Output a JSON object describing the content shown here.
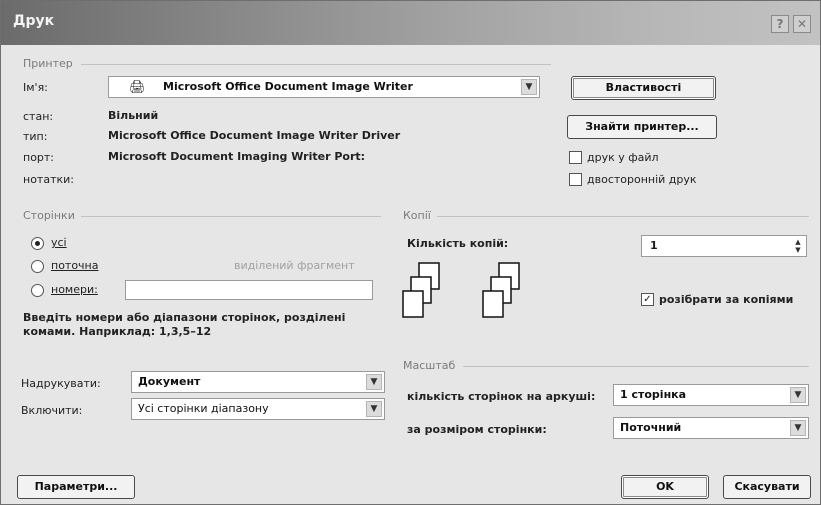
{
  "window": {
    "title": "Друк",
    "help_glyph": "?",
    "close_glyph": "✕"
  },
  "printer": {
    "group_label": "Принтер",
    "name_label": "Ім'я:",
    "name_value": "Microsoft Office Document Image Writer",
    "status_label": "стан:",
    "status_value": "Вільний",
    "type_label": "тип:",
    "type_value": "Microsoft Office Document Image Writer Driver",
    "port_label": "порт:",
    "port_value": "Microsoft Document Imaging Writer Port:",
    "notes_label": "нотатки:",
    "properties_button": "Властивості",
    "find_printer_button": "Знайти принтер...",
    "print_to_file_label": "друк у файл",
    "duplex_label": "двосторонній друк"
  },
  "pages": {
    "group_label": "Сторінки",
    "all_label": "усі",
    "current_label": "поточна",
    "selection_label": "виділений фрагмент",
    "numbers_label": "номери:",
    "numbers_value": "",
    "hint": "Введіть номери або діапазони сторінок, розділені комами. Наприклад: 1,3,5–12"
  },
  "copies": {
    "group_label": "Копії",
    "count_label": "Кількість копій:",
    "count_value": "1",
    "collate_label": "розібрати за копіями",
    "collate_checked": true
  },
  "print_what": {
    "label": "Надрукувати:",
    "value": "Документ",
    "include_label": "Включити:",
    "include_value": "Усі сторінки діапазону"
  },
  "zoom": {
    "group_label": "Масштаб",
    "pages_per_sheet_label": "кількість сторінок на аркуші:",
    "pages_per_sheet_value": "1 сторінка",
    "scale_label": "за розміром сторінки:",
    "scale_value": "Поточний"
  },
  "footer": {
    "options_button": "Параметри...",
    "ok_button": "OK",
    "cancel_button": "Скасувати"
  },
  "icons": {
    "printer": "printer-icon",
    "dropdown": "chevron-down-icon",
    "pages": "page-stack-icon"
  }
}
